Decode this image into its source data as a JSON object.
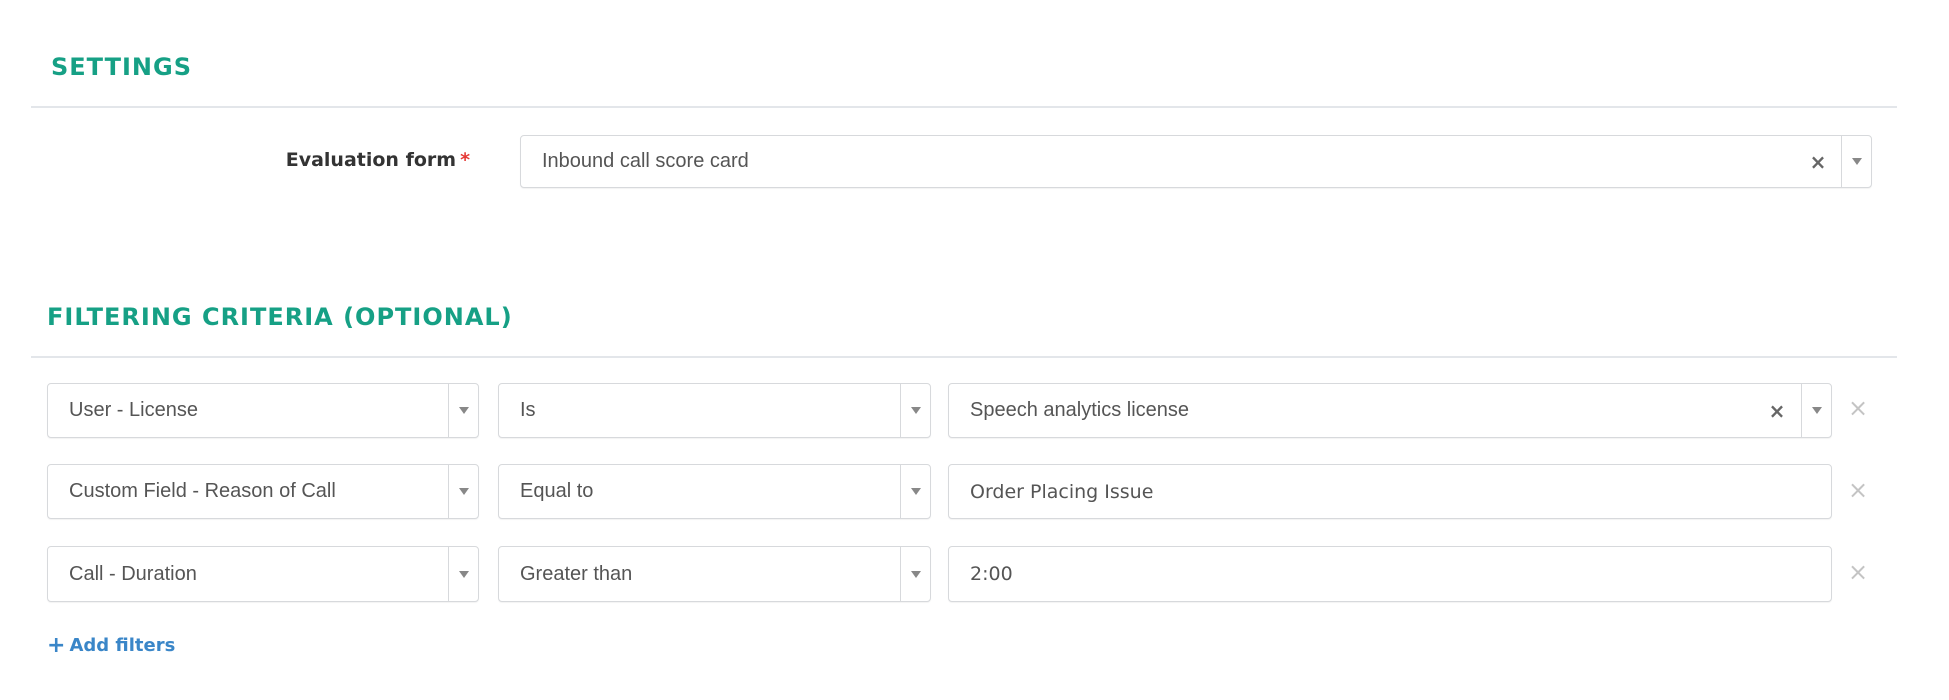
{
  "settings": {
    "heading": "SETTINGS",
    "evaluation_form": {
      "label": "Evaluation form",
      "required_marker": "*",
      "value": "Inbound call score card",
      "clear_icon": "×"
    }
  },
  "filtering": {
    "heading": "FILTERING CRITERIA (OPTIONAL)",
    "rows": [
      {
        "field": "User - License",
        "operator": "Is",
        "value": "Speech analytics license",
        "value_type": "select",
        "remove_icon": "×",
        "clear_icon": "×"
      },
      {
        "field": "Custom Field - Reason of Call",
        "operator": "Equal to",
        "value": "Order Placing Issue",
        "value_type": "text",
        "remove_icon": "×"
      },
      {
        "field": "Call - Duration",
        "operator": "Greater than",
        "value": "2:00",
        "value_type": "text",
        "remove_icon": "×"
      }
    ],
    "add_filters": {
      "icon": "+",
      "label": "Add filters"
    }
  },
  "colors": {
    "heading": "#16a085",
    "link": "#3a86c8",
    "required": "#e53935"
  }
}
